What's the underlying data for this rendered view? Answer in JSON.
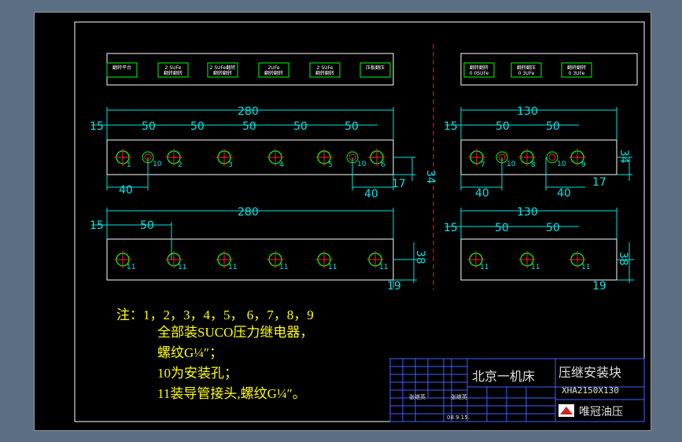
{
  "left_labels": [
    "翻转平台",
    "2 SUFe",
    "2 SUFe翻转",
    "2UFe",
    "2 SUFe",
    "压板翻压"
  ],
  "left_label_top": [
    "",
    "翻转翻转",
    "翻转翻转",
    "翻转翻转",
    "翻转翻转",
    ""
  ],
  "right_labels": [
    "翻转翻转",
    "翻转翻压",
    "翻转翻转"
  ],
  "right_label_sub": [
    "0 0SUFe",
    "0 3UFe",
    "0 3UFe"
  ],
  "dims": {
    "top_left_total": "280",
    "top_left_offset": "15",
    "top_left_spacing": "50",
    "top_left_40a": "40",
    "top_left_40b": "40",
    "top_left_17": "17",
    "top_left_34": "34",
    "bot_left_total": "280",
    "bot_left_offset": "15",
    "bot_left_spacing": "50",
    "bot_left_38": "38",
    "bot_left_19": "19",
    "top_right_total": "130",
    "top_right_offset": "15",
    "top_right_spacing": "50",
    "top_right_40a": "40",
    "top_right_40b": "40",
    "top_right_17": "17",
    "top_right_34": "34",
    "bot_right_total": "130",
    "bot_right_offset": "15",
    "bot_right_spacing": "50",
    "bot_right_38": "38",
    "bot_right_19": "19"
  },
  "hole_labels_top_left": [
    "1",
    "10",
    "2",
    "3",
    "4",
    "5",
    "10",
    "6"
  ],
  "hole_labels_top_right": [
    "7",
    "10",
    "8",
    "10",
    "9"
  ],
  "hole_label_bottom": "11",
  "notes": {
    "line1": "注：1，2，3，4，5， 6，7，8，9",
    "line2": "全部装SUCO压力继电器，",
    "line3": "螺纹G¼″；",
    "line4": "10为安装孔；",
    "line5": "11装导管接头,螺纹G¼″。"
  },
  "title_block": {
    "company": "北京一机床",
    "title": "压继安装块",
    "drawing_no": "XHA2150X130",
    "maker": "唯冠油压",
    "designer1": "张继英",
    "designer2": "张继英",
    "date": "08.9.15."
  },
  "colors": {
    "cyan": "#00e5e5",
    "yellow": "#ffff00",
    "green": "#00ff00",
    "red": "#ff2020",
    "white": "#ffffff"
  }
}
